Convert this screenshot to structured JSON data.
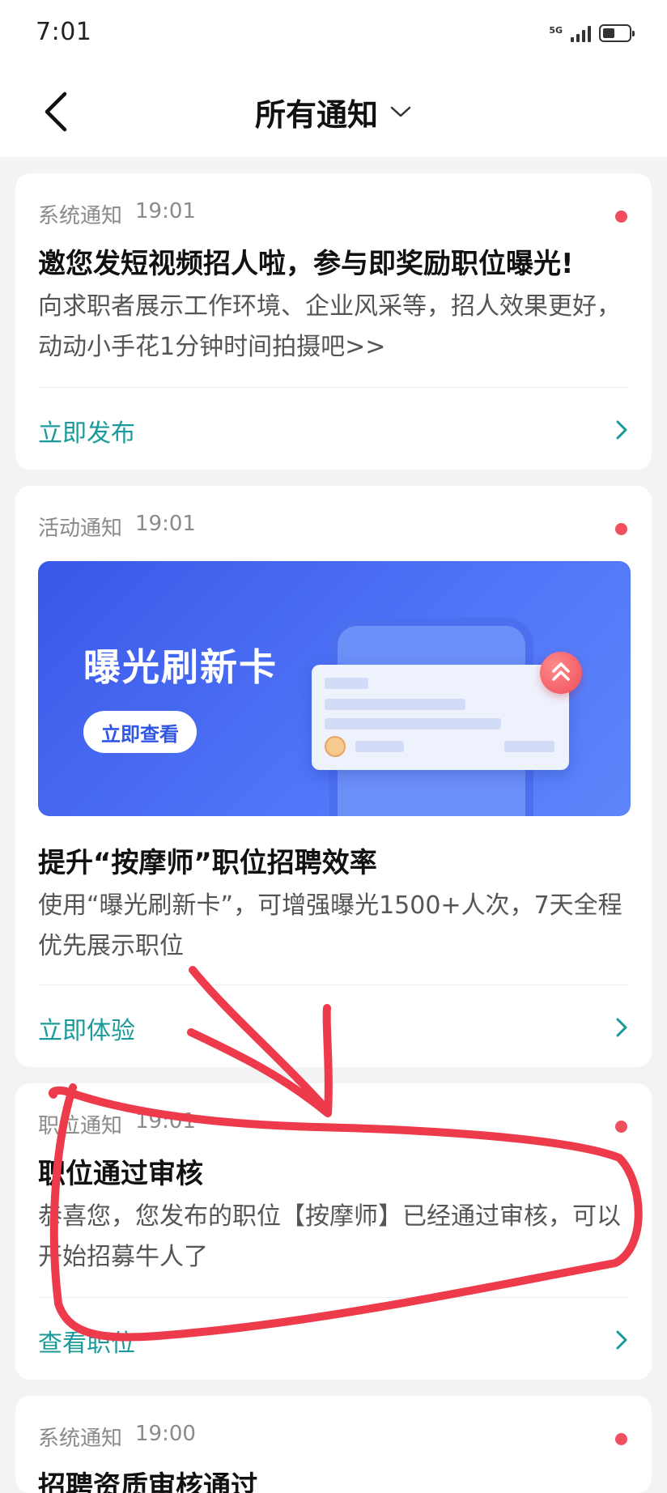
{
  "status_bar": {
    "time": "7:01",
    "network": "5G"
  },
  "header": {
    "title": "所有通知"
  },
  "notifications": [
    {
      "category": "系统通知",
      "time": "19:01",
      "title": "邀您发短视频招人啦，参与即奖励职位曝光!",
      "body": "向求职者展示工作环境、企业风采等，招人效果更好，动动小手花1分钟时间拍摄吧>>",
      "action": "立即发布"
    },
    {
      "category": "活动通知",
      "time": "19:01",
      "banner": {
        "title": "曝光刷新卡",
        "button": "立即查看"
      },
      "title": "提升“按摩师”职位招聘效率",
      "body": "使用“曝光刷新卡”，可增强曝光1500+人次，7天全程优先展示职位",
      "action": "立即体验"
    },
    {
      "category": "职位通知",
      "time": "19:01",
      "title": "职位通过审核",
      "body": "恭喜您，您发布的职位【按摩师】已经通过审核，可以开始招募牛人了",
      "action": "查看职位"
    },
    {
      "category": "系统通知",
      "time": "19:00",
      "title": "招聘资质审核通过"
    }
  ],
  "colors": {
    "accent": "#1a9a9a",
    "unread_dot": "#ef4f5f",
    "annotation": "#ee3b4b"
  }
}
